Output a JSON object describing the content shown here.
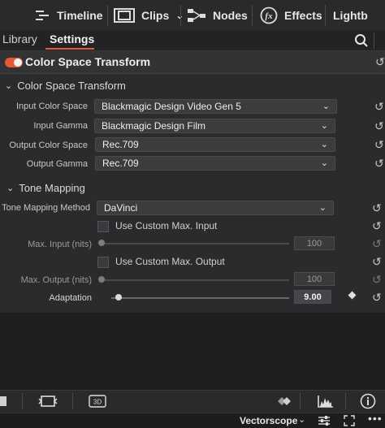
{
  "toolbar": {
    "timeline": "Timeline",
    "clips": "Clips",
    "nodes": "Nodes",
    "effects": "Effects",
    "lightbox": "Lightb"
  },
  "tabs": {
    "library": "Library",
    "settings": "Settings"
  },
  "panel": {
    "title": "Color Space Transform",
    "enabled": true
  },
  "cst": {
    "section_title": "Color Space Transform",
    "input_color_space": {
      "label": "Input Color Space",
      "value": "Blackmagic Design Video Gen 5"
    },
    "input_gamma": {
      "label": "Input Gamma",
      "value": "Blackmagic Design Film"
    },
    "output_color_space": {
      "label": "Output Color Space",
      "value": "Rec.709"
    },
    "output_gamma": {
      "label": "Output Gamma",
      "value": "Rec.709"
    }
  },
  "tone": {
    "section_title": "Tone Mapping",
    "method": {
      "label": "Tone Mapping Method",
      "value": "DaVinci"
    },
    "custom_max_input": {
      "label": "Use Custom Max. Input",
      "checked": false
    },
    "max_input": {
      "label": "Max. Input (nits)",
      "value": "100",
      "level": 0.0
    },
    "custom_max_output": {
      "label": "Use Custom Max. Output",
      "checked": false
    },
    "max_output": {
      "label": "Max. Output (nits)",
      "value": "100",
      "level": 0.0
    },
    "adaptation": {
      "label": "Adaptation",
      "value": "9.00",
      "level": 0.09
    }
  },
  "statusbar": {
    "scope": "Vectorscope"
  },
  "colors": {
    "accent": "#e35a35",
    "panel": "#2b2b2d",
    "toolbar": "#2a2a2d"
  },
  "icons": [
    "timeline-icon",
    "clips-icon",
    "nodes-icon",
    "fx-icon",
    "search-icon",
    "reset-icon",
    "keyframe-diamond-icon",
    "histogram-icon",
    "info-icon",
    "3d-icon",
    "more-icon"
  ]
}
